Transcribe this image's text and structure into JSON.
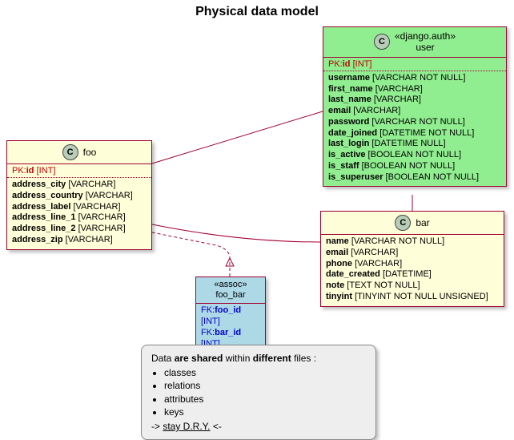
{
  "title": "Physical data model",
  "entities": {
    "user": {
      "stereotype": "«django.auth»",
      "name": "user",
      "pk": {
        "label": "PK:",
        "name": "id",
        "type": "[INT]"
      },
      "attrs": [
        {
          "name": "username",
          "type": "[VARCHAR NOT NULL]"
        },
        {
          "name": "first_name",
          "type": "[VARCHAR]"
        },
        {
          "name": "last_name",
          "type": "[VARCHAR]"
        },
        {
          "name": "email",
          "type": "[VARCHAR]"
        },
        {
          "name": "password",
          "type": "[VARCHAR NOT NULL]"
        },
        {
          "name": "date_joined",
          "type": "[DATETIME NOT NULL]"
        },
        {
          "name": "last_login",
          "type": "[DATETIME NULL]"
        },
        {
          "name": "is_active",
          "type": "[BOOLEAN NOT NULL]"
        },
        {
          "name": "is_staff",
          "type": "[BOOLEAN NOT NULL]"
        },
        {
          "name": "is_superuser",
          "type": "[BOOLEAN NOT NULL]"
        }
      ]
    },
    "foo": {
      "name": "foo",
      "pk": {
        "label": "PK:",
        "name": "id",
        "type": "[INT]"
      },
      "attrs": [
        {
          "name": "address_city",
          "type": "[VARCHAR]"
        },
        {
          "name": "address_country",
          "type": "[VARCHAR]"
        },
        {
          "name": "address_label",
          "type": "[VARCHAR]"
        },
        {
          "name": "address_line_1",
          "type": "[VARCHAR]"
        },
        {
          "name": "address_line_2",
          "type": "[VARCHAR]"
        },
        {
          "name": "address_zip",
          "type": "[VARCHAR]"
        }
      ]
    },
    "bar": {
      "name": "bar",
      "attrs": [
        {
          "name": "name",
          "type": "[VARCHAR NOT NULL]"
        },
        {
          "name": "email",
          "type": "[VARCHAR]"
        },
        {
          "name": "phone",
          "type": "[VARCHAR]"
        },
        {
          "name": "date_created",
          "type": "[DATETIME]"
        },
        {
          "name": "note",
          "type": "[TEXT NOT NULL]"
        },
        {
          "name": "tinyint",
          "type": "[TINYINT NOT NULL UNSIGNED]"
        }
      ]
    },
    "foo_bar": {
      "stereotype": "«assoc»",
      "name": "foo_bar",
      "fks": [
        {
          "label": "FK:",
          "name": "foo_id",
          "type": "[INT]"
        },
        {
          "label": "FK:",
          "name": "bar_id",
          "type": "[INT]"
        }
      ]
    }
  },
  "note": {
    "intro_pre": "Data ",
    "intro_b1": "are shared",
    "intro_mid": " within ",
    "intro_b2": "different",
    "intro_post": " files :",
    "items": [
      "classes",
      "relations",
      "attributes",
      "keys"
    ],
    "outro_pre": "-> ",
    "outro_u": "stay D.R.Y.",
    "outro_post": " <-"
  },
  "glyphs": {
    "C": "C"
  }
}
